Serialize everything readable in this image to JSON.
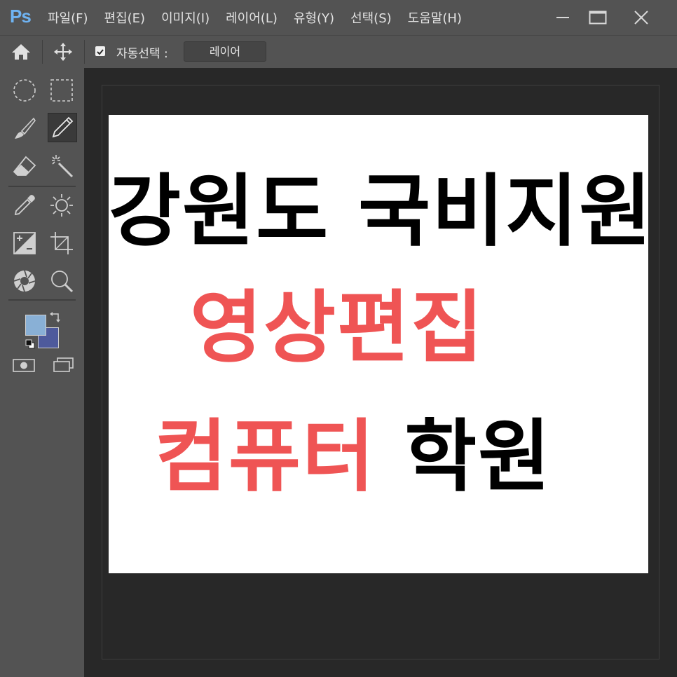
{
  "app": {
    "logo": "Ps"
  },
  "menu": [
    "파일(F)",
    "편집(E)",
    "이미지(I)",
    "레이어(L)",
    "유형(Y)",
    "선택(S)",
    "도움말(H)"
  ],
  "options": {
    "auto_select_label": "자동선택 :",
    "auto_select_checked": true,
    "auto_select_target": "레이어"
  },
  "colors": {
    "foreground": "#89b0d6",
    "background": "#4e5a9c",
    "accent_red": "#ef5454",
    "logo_blue": "#6fb3f2"
  },
  "artwork": {
    "line1": "강원도 국비지원",
    "line2": "영상편집",
    "line3_red": "컴퓨터",
    "line3_black": "학원"
  },
  "tools": [
    "ellipse-marquee",
    "rect-marquee",
    "brush",
    "pencil",
    "eraser",
    "magic-wand",
    "eyedropper",
    "dodge-sun",
    "adjustment",
    "crop",
    "shutter",
    "zoom"
  ]
}
